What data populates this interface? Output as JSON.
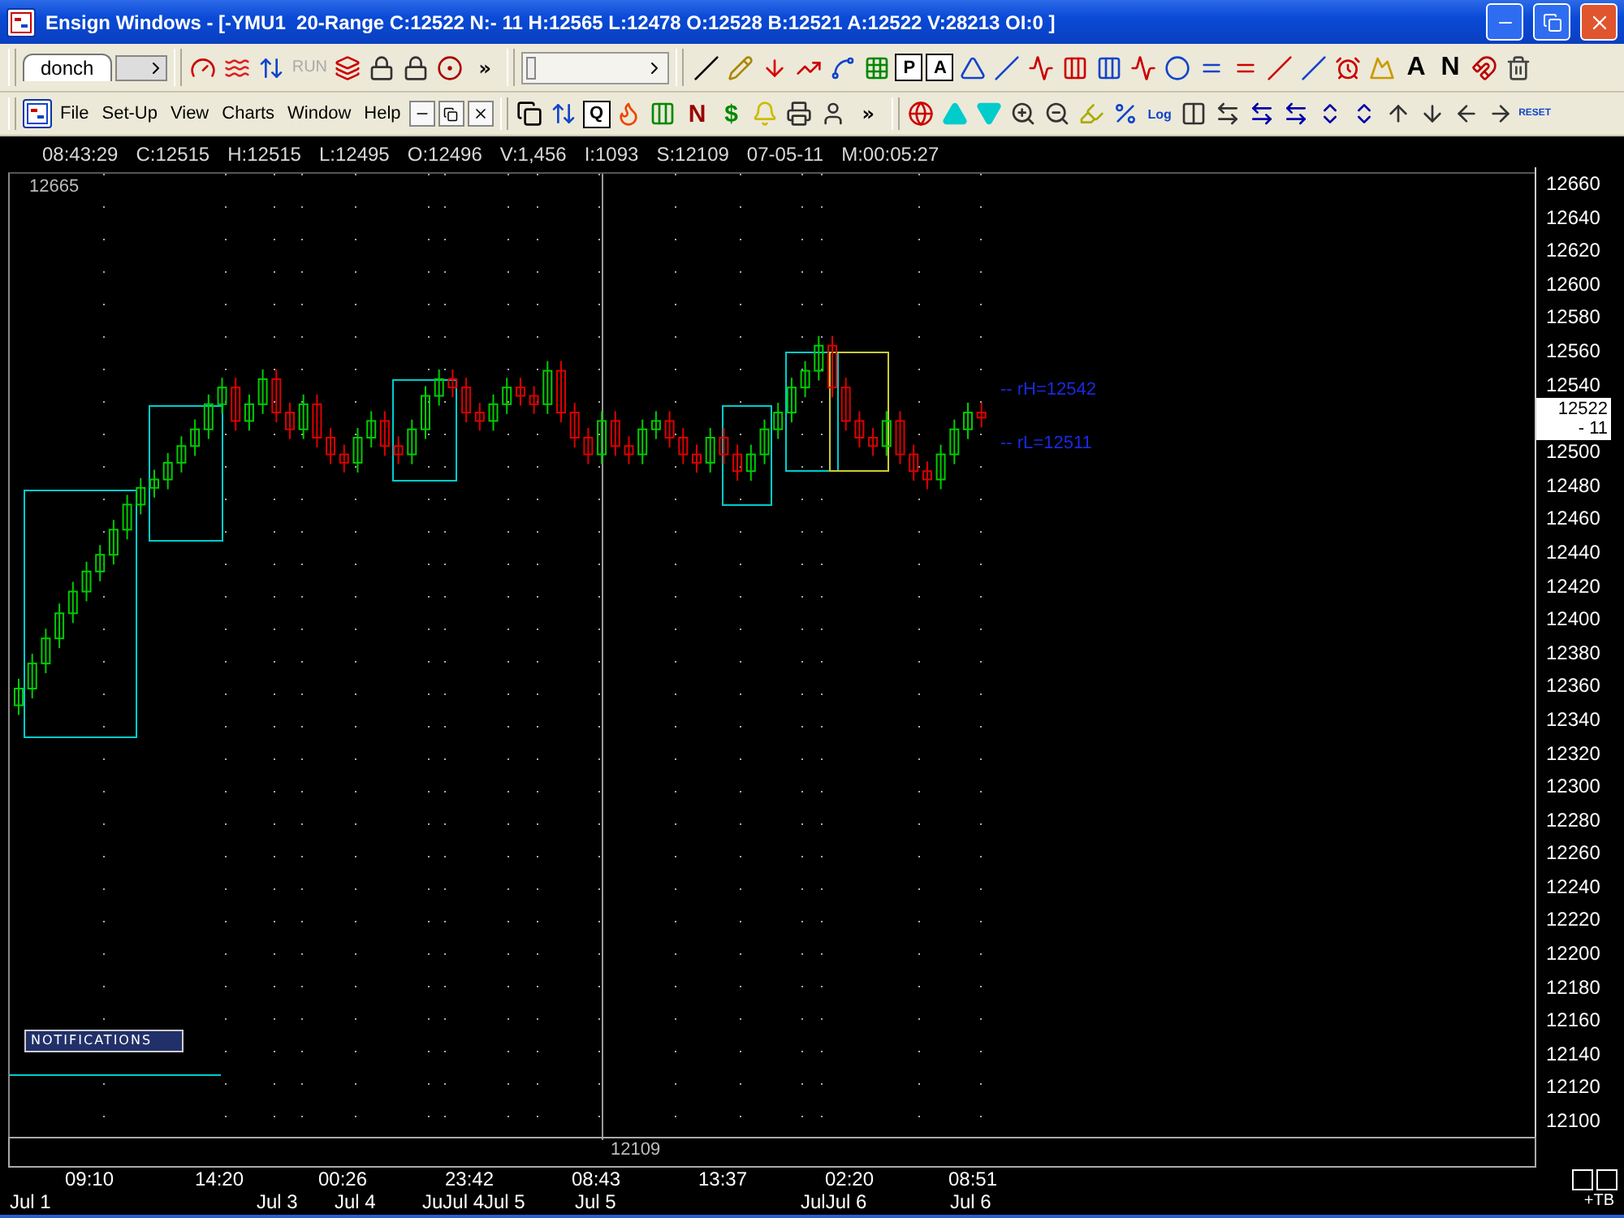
{
  "window": {
    "title": "Ensign Windows - [-YMU1  20-Range C:12522 N:- 11 H:12565 L:12478 O:12528 B:12521 A:12522 V:28213 OI:0 ]"
  },
  "toolbar_top": {
    "tab": "donch",
    "run": {
      "label": "RUN",
      "disabled": true
    },
    "overflow": "»",
    "boxed_letters": [
      "P",
      "A"
    ],
    "letters": [
      "A",
      "N"
    ]
  },
  "menu_bar": {
    "menus": [
      "File",
      "Set-Up",
      "View",
      "Charts",
      "Window",
      "Help"
    ],
    "letters": [
      "Q",
      "N",
      "$"
    ],
    "overflow": "»",
    "log": "Log",
    "reset": "RESET"
  },
  "quote_strip": [
    "08:43:29",
    "C:12515",
    "H:12515",
    "L:12495",
    "O:12496",
    "V:1,456",
    "I:1093",
    "S:12109",
    "07-05-11",
    "M:00:05:27"
  ],
  "chart": {
    "top_label": "12665",
    "cursor_label": "12109",
    "levels": [
      "-- rH=12542",
      "-- rL=12511"
    ],
    "price_tag": "12522",
    "change_tag": "- 11",
    "notifications": "NOTIFICATIONS",
    "y_axis": [
      "12660",
      "12640",
      "12620",
      "12600",
      "12580",
      "12560",
      "12540",
      "12500",
      "12480",
      "12460",
      "12440",
      "12420",
      "12400",
      "12380",
      "12360",
      "12340",
      "12320",
      "12300",
      "12280",
      "12260",
      "12240",
      "12220",
      "12200",
      "12180",
      "12160",
      "12140",
      "12120",
      "12100"
    ],
    "time_labels": [
      "09:10",
      "14:20",
      "00:26",
      "23:42",
      "08:43",
      "13:37",
      "02:20",
      "08:51"
    ],
    "date_labels": [
      "Jul 1",
      "Jul 3",
      "Jul 4",
      "JuJul 4",
      "Jul 5",
      "Jul 5",
      "JulJul 6",
      "Jul 6"
    ],
    "corner": "+TB"
  }
}
